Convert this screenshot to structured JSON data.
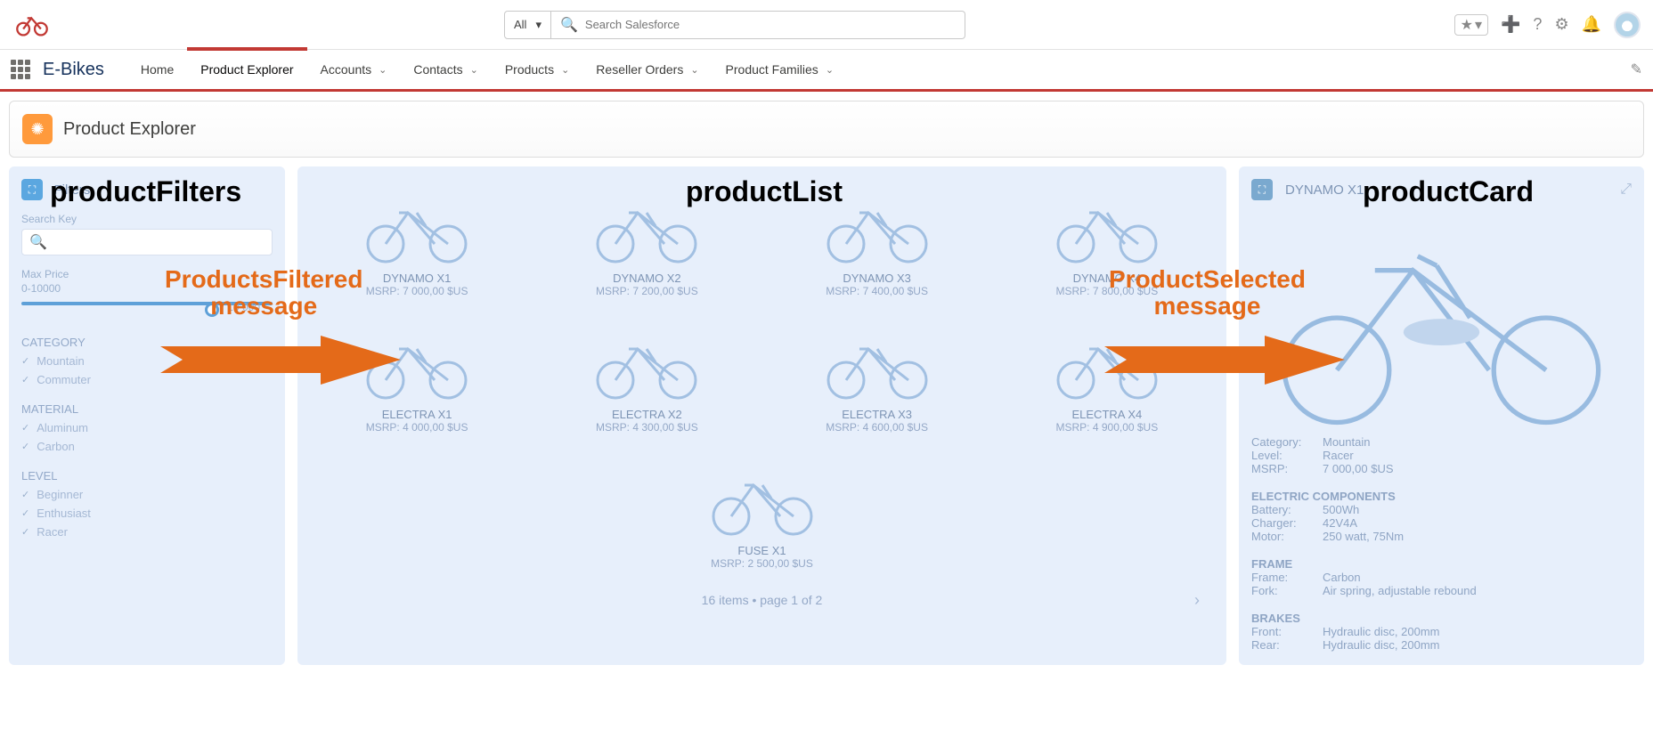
{
  "header": {
    "search_scope": "All",
    "search_placeholder": "Search Salesforce"
  },
  "nav": {
    "app_name": "E-Bikes",
    "tabs": [
      "Home",
      "Product Explorer",
      "Accounts",
      "Contacts",
      "Products",
      "Reseller Orders",
      "Product Families"
    ],
    "active_tab": "Product Explorer"
  },
  "page": {
    "title": "Product Explorer"
  },
  "overlays": {
    "filters_label": "productFilters",
    "list_label": "productList",
    "card_label": "productCard",
    "msg1_line1": "ProductsFiltered",
    "msg1_line2": "message",
    "msg2_line1": "ProductSelected",
    "msg2_line2": "message"
  },
  "filters": {
    "panel_label": "Filters",
    "search_label": "Search Key",
    "max_price_label": "Max Price",
    "max_price_range": "0-10000",
    "slider_value": "10 000",
    "category_title": "CATEGORY",
    "categories": [
      "Mountain",
      "Commuter"
    ],
    "material_title": "MATERIAL",
    "materials": [
      "Aluminum",
      "Carbon"
    ],
    "level_title": "LEVEL",
    "levels": [
      "Beginner",
      "Enthusiast",
      "Racer"
    ]
  },
  "products": [
    {
      "name": "DYNAMO X1",
      "msrp": "MSRP: 7 000,00 $US"
    },
    {
      "name": "DYNAMO X2",
      "msrp": "MSRP: 7 200,00 $US"
    },
    {
      "name": "DYNAMO X3",
      "msrp": "MSRP: 7 400,00 $US"
    },
    {
      "name": "DYNAMO X4",
      "msrp": "MSRP: 7 800,00 $US"
    },
    {
      "name": "ELECTRA X1",
      "msrp": "MSRP: 4 000,00 $US"
    },
    {
      "name": "ELECTRA X2",
      "msrp": "MSRP: 4 300,00 $US"
    },
    {
      "name": "ELECTRA X3",
      "msrp": "MSRP: 4 600,00 $US"
    },
    {
      "name": "ELECTRA X4",
      "msrp": "MSRP: 4 900,00 $US"
    }
  ],
  "fuse": {
    "name": "FUSE X1",
    "msrp": "MSRP: 2 500,00 $US"
  },
  "pagination": "16 items • page 1 of 2",
  "card": {
    "title": "DYNAMO X1",
    "rows": {
      "category_k": "Category:",
      "category_v": "Mountain",
      "level_k": "Level:",
      "level_v": "Racer",
      "msrp_k": "MSRP:",
      "msrp_v": "7 000,00 $US"
    },
    "electric_title": "ELECTRIC COMPONENTS",
    "electric": {
      "battery_k": "Battery:",
      "battery_v": "500Wh",
      "charger_k": "Charger:",
      "charger_v": "42V4A",
      "motor_k": "Motor:",
      "motor_v": "250 watt, 75Nm"
    },
    "frame_title": "FRAME",
    "frame": {
      "frame_k": "Frame:",
      "frame_v": "Carbon",
      "fork_k": "Fork:",
      "fork_v": "Air spring, adjustable rebound"
    },
    "brakes_title": "BRAKES",
    "brakes": {
      "front_k": "Front:",
      "front_v": "Hydraulic disc, 200mm",
      "rear_k": "Rear:",
      "rear_v": "Hydraulic disc, 200mm"
    }
  }
}
